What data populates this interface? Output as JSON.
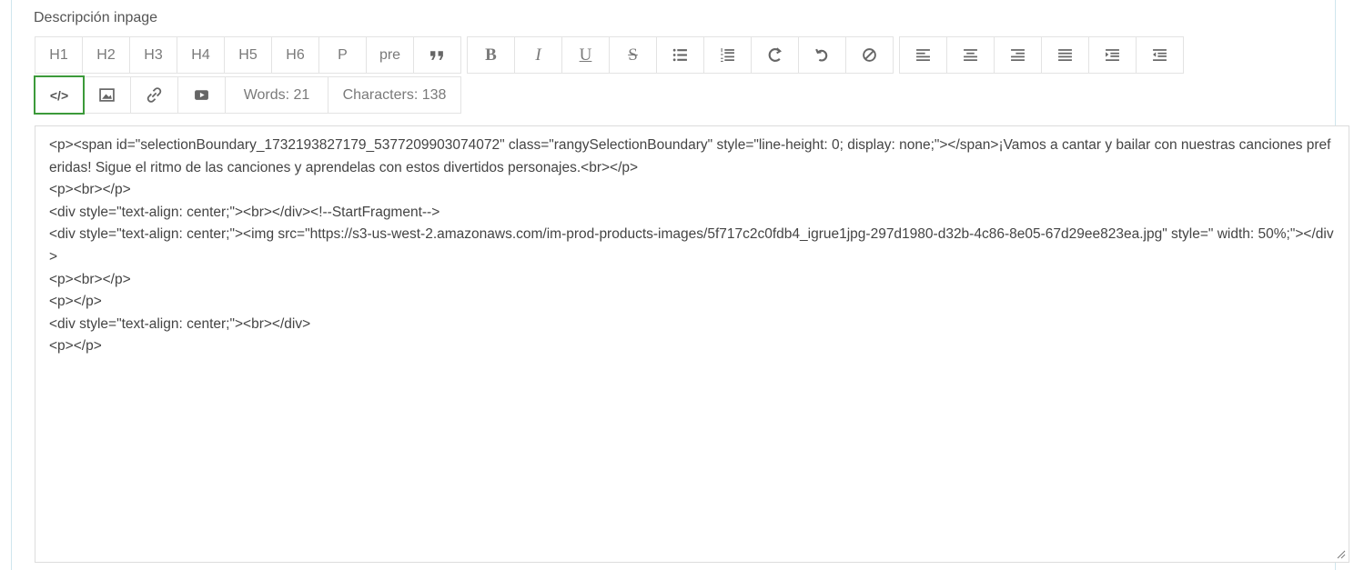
{
  "field": {
    "label": "Descripción inpage"
  },
  "toolbar": {
    "row1": {
      "headings": [
        "H1",
        "H2",
        "H3",
        "H4",
        "H5",
        "H6",
        "P",
        "pre"
      ],
      "quote_icon": "quote-icon",
      "format": {
        "bold": "B",
        "italic": "I",
        "underline": "U",
        "strike": "S"
      },
      "list_icons": [
        "unordered-list-icon",
        "ordered-list-icon"
      ],
      "history_icons": [
        "redo-icon",
        "undo-icon",
        "clear-format-icon"
      ],
      "align_icons": [
        "align-left-icon",
        "align-center-icon",
        "align-right-icon",
        "align-justify-icon",
        "indent-icon",
        "outdent-icon"
      ]
    },
    "row2": {
      "html_label": "</>",
      "icons": [
        "image-icon",
        "link-icon",
        "video-icon"
      ],
      "words": "Words: 21",
      "characters": "Characters: 138"
    }
  },
  "editor": {
    "lines": [
      "<p><span id=\"selectionBoundary_1732193827179_5377209903074072\" class=\"rangySelectionBoundary\" style=\"line-height: 0; display: none;\"></span>¡Vamos a cantar y bailar con nuestras canciones preferidas! Sigue el ritmo de las canciones y aprendelas con estos divertidos personajes.<br></p>",
      "<p><br></p>",
      "<div style=\"text-align: center;\"><br></div><!--StartFragment-->",
      "<div style=\"text-align: center;\"><img src=\"https://s3-us-west-2.amazonaws.com/im-prod-products-images/5f717c2c0fdb4_igrue1jpg-297d1980-d32b-4c86-8e05-67d29ee823ea.jpg\" style=\" width: 50%;\"></div>",
      "<p><br></p>",
      "<p></p>",
      "<div style=\"text-align: center;\"><br></div>",
      "<p></p>"
    ]
  }
}
